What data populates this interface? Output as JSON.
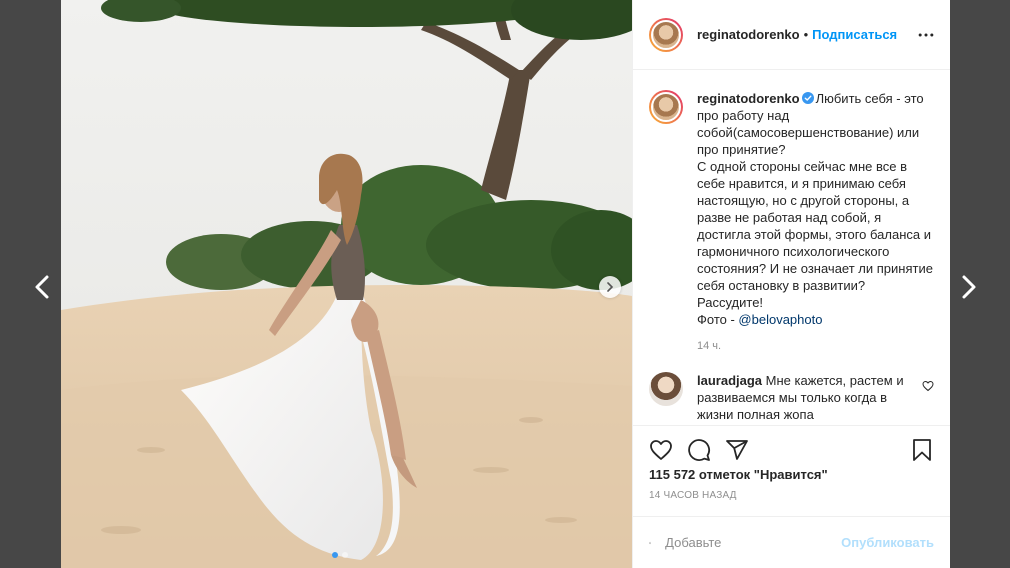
{
  "post": {
    "author": "reginatodorenko",
    "follow_label": "Подписаться",
    "bullet": "•",
    "more_icon": "more-horizontal-icon"
  },
  "caption": {
    "author": "reginatodorenko",
    "text": "Любить себя - это про работу над собой(самосовершенствование) или про принятие?\nС одной стороны сейчас мне все в себе нравится, и я принимаю себя настоящую, но с другой стороны, а разве не работая над собой, я достигла этой формы, этого баланса и гармоничного психологического состояния? И не означает ли принятие себя остановку в развитии? Рассудите!\nФото - ",
    "mention": "@belovaphoto",
    "time": "14 ч."
  },
  "comments": [
    {
      "author": "lauradjaga",
      "text": "Мне кажется, растем и развиваемся мы только когда в жизни полная жопа"
    }
  ],
  "stats": {
    "likes": "115 572 отметок \"Нравится\"",
    "posted": "14 ЧАСОВ НАЗАД"
  },
  "composer": {
    "placeholder": "Добавьте",
    "publish_label": "Опубликовать"
  },
  "carousel": {
    "total": 2,
    "active": 1
  },
  "colors": {
    "accent": "#0095f6",
    "carousel_active": "#3897f0",
    "publish_disabled": "#b2dffc",
    "backdrop": "#474747"
  }
}
